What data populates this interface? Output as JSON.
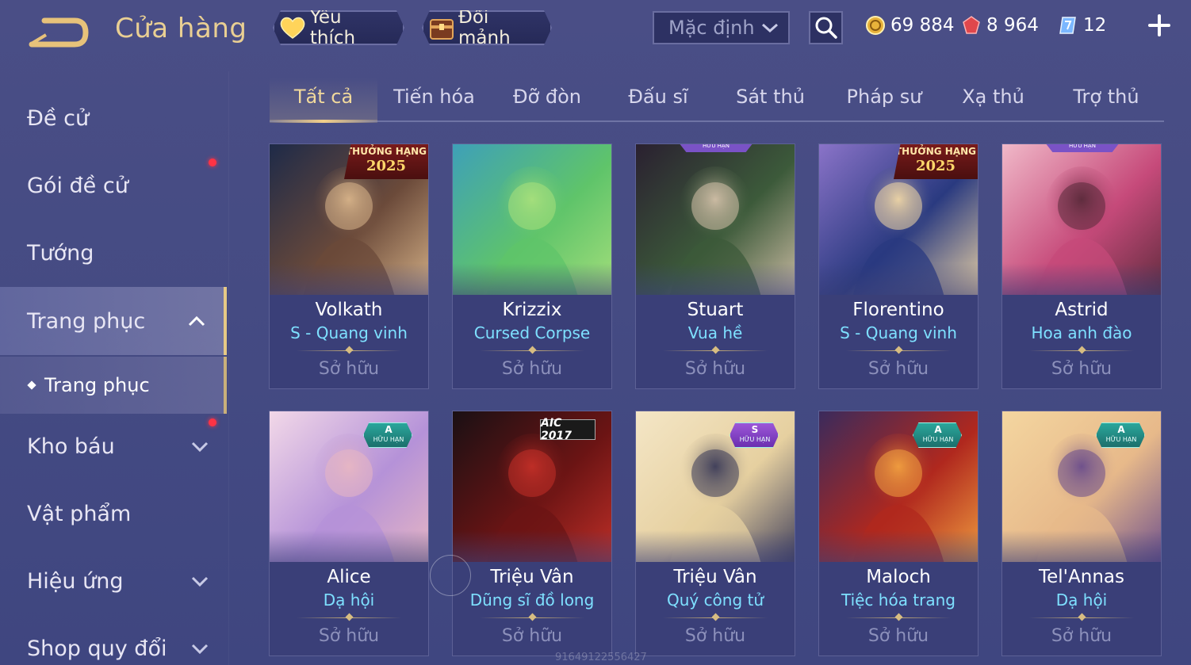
{
  "header": {
    "title": "Cửa hàng",
    "favorites_label": "Yêu thích",
    "exchange_shards_label": "Đổi mảnh",
    "sort_value": "Mặc định",
    "currencies": [
      {
        "name": "gold-coin-icon",
        "value": "69 884"
      },
      {
        "name": "voucher-gem-icon",
        "value": "8 964"
      },
      {
        "name": "quan-huy-icon",
        "value": "12"
      }
    ]
  },
  "sidebar": {
    "items": [
      {
        "label": "Đề cử"
      },
      {
        "label": "Gói đề cử"
      },
      {
        "label": "Tướng"
      },
      {
        "label": "Trang phục"
      },
      {
        "label": "Kho báu"
      },
      {
        "label": "Vật phẩm"
      },
      {
        "label": "Hiệu ứng"
      },
      {
        "label": "Shop quy đổi"
      }
    ],
    "sub_item": "Trang phục"
  },
  "tabs": [
    "Tất cả",
    "Tiến hóa",
    "Đỡ đòn",
    "Đấu sĩ",
    "Sát thủ",
    "Pháp sư",
    "Xạ thủ",
    "Trợ thủ"
  ],
  "cards": [
    {
      "hero": "Volkath",
      "skin": "S - Quang vinh",
      "status": "Sở hữu",
      "badge": "rank",
      "badge_l1": "THƯỞNG HẠNG",
      "badge_l2": "2025",
      "palette": [
        "#1e2a48",
        "#6b4a3a",
        "#d9b58a"
      ]
    },
    {
      "hero": "Krizzix",
      "skin": "Cursed Corpse",
      "status": "Sở hữu",
      "badge": "none",
      "palette": [
        "#3ea0b8",
        "#5fc46a",
        "#a8e07c"
      ]
    },
    {
      "hero": "Stuart",
      "skin": "Vua hề",
      "status": "Sở hữu",
      "badge": "top",
      "badge_text": "HỮU HẠN",
      "palette": [
        "#2a2030",
        "#3c5a3a",
        "#d2c0a8"
      ]
    },
    {
      "hero": "Florentino",
      "skin": "S - Quang vinh",
      "status": "Sở hữu",
      "badge": "rank",
      "badge_l1": "THƯỞNG HẠNG",
      "badge_l2": "2025",
      "palette": [
        "#8a73c8",
        "#2a3a80",
        "#f0d7a6"
      ]
    },
    {
      "hero": "Astrid",
      "skin": "Hoa anh đào",
      "status": "Sở hữu",
      "badge": "top",
      "badge_text": "HỮU HẠN",
      "palette": [
        "#f0b8c8",
        "#c64a7a",
        "#5a2a3a"
      ]
    },
    {
      "hero": "Alice",
      "skin": "Dạ hội",
      "status": "Sở hữu",
      "badge": "limit",
      "badge_grade": "A",
      "badge_text": "HỮU HẠN",
      "palette": [
        "#f2d8e8",
        "#b592d8",
        "#e8b7c2"
      ]
    },
    {
      "hero": "Triệu Vân",
      "skin": "Dũng sĩ đồ long",
      "status": "Sở hữu",
      "badge": "aic",
      "badge_text": "AIC 2017",
      "palette": [
        "#1a1014",
        "#6b1414",
        "#c23028"
      ]
    },
    {
      "hero": "Triệu Vân",
      "skin": "Quý công tử",
      "status": "Sở hữu",
      "badge": "limit-s",
      "badge_grade": "S",
      "badge_text": "HỮU HẠN",
      "palette": [
        "#f4e6c6",
        "#e6d0a0",
        "#3a3a58"
      ]
    },
    {
      "hero": "Maloch",
      "skin": "Tiệc hóa trang",
      "status": "Sở hữu",
      "badge": "limit",
      "badge_grade": "A",
      "badge_text": "HỮU HẠN",
      "palette": [
        "#3a2a5c",
        "#b0281e",
        "#f2a040"
      ]
    },
    {
      "hero": "Tel'Annas",
      "skin": "Dạ hội",
      "status": "Sở hữu",
      "badge": "limit",
      "badge_grade": "A",
      "badge_text": "HỮU HẠN",
      "palette": [
        "#f4d6a0",
        "#e7b98a",
        "#6a4c8c"
      ]
    }
  ],
  "watermark": "91649122556427"
}
